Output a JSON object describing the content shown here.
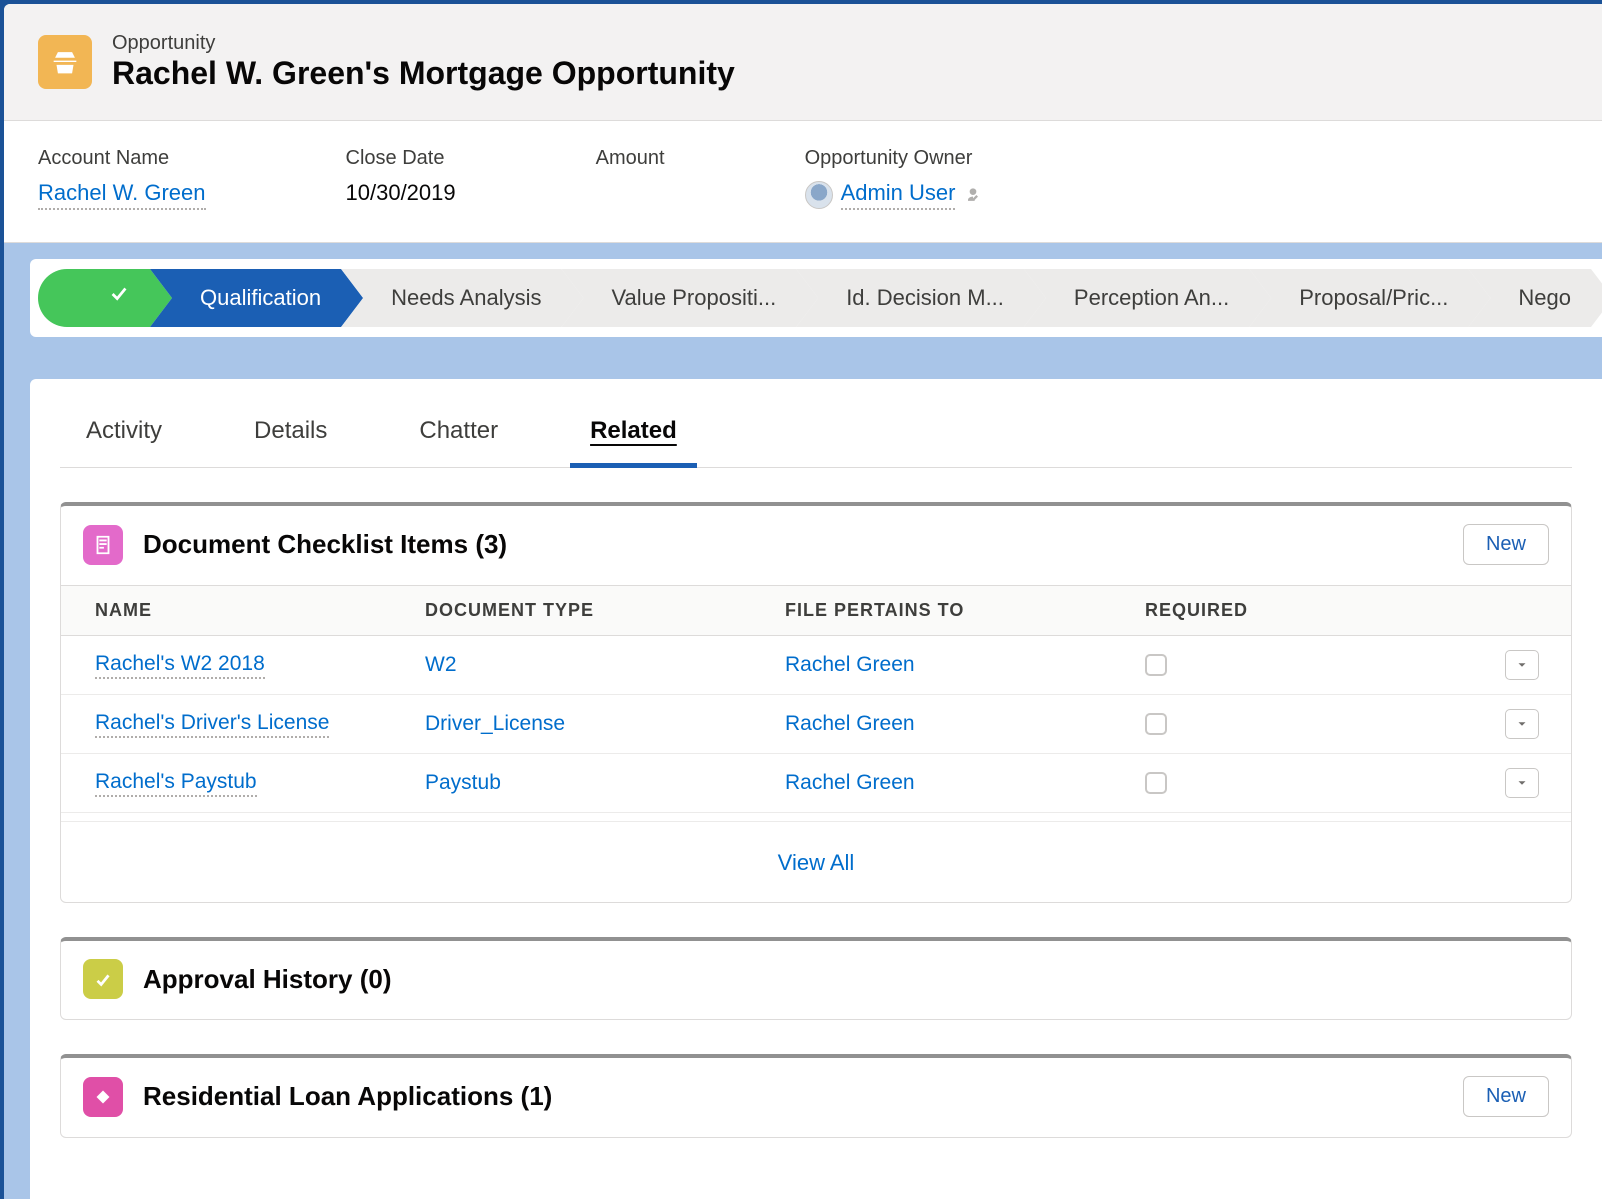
{
  "header": {
    "object_label": "Opportunity",
    "record_title": "Rachel W. Green's Mortgage Opportunity"
  },
  "fields": {
    "account": {
      "label": "Account Name",
      "value": "Rachel W. Green"
    },
    "close_date": {
      "label": "Close Date",
      "value": "10/30/2019"
    },
    "amount": {
      "label": "Amount",
      "value": ""
    },
    "owner": {
      "label": "Opportunity Owner",
      "value": "Admin User"
    }
  },
  "path": {
    "stages": [
      "",
      "Qualification",
      "Needs Analysis",
      "Value Propositi...",
      "Id. Decision M...",
      "Perception An...",
      "Proposal/Pric...",
      "Nego"
    ]
  },
  "tabs": [
    "Activity",
    "Details",
    "Chatter",
    "Related"
  ],
  "active_tab_index": 3,
  "related": {
    "checklist": {
      "title": "Document Checklist Items (3)",
      "new_label": "New",
      "columns": [
        "NAME",
        "DOCUMENT TYPE",
        "FILE PERTAINS TO",
        "REQUIRED"
      ],
      "rows": [
        {
          "name": "Rachel's W2 2018",
          "doc_type": "W2",
          "pertains": "Rachel Green",
          "required": false
        },
        {
          "name": "Rachel's Driver's License",
          "doc_type": "Driver_License",
          "pertains": "Rachel Green",
          "required": false
        },
        {
          "name": "Rachel's Paystub",
          "doc_type": "Paystub",
          "pertains": "Rachel Green",
          "required": false
        }
      ],
      "view_all": "View All"
    },
    "approval": {
      "title": "Approval History (0)"
    },
    "loans": {
      "title": "Residential Loan Applications (1)",
      "new_label": "New"
    }
  }
}
